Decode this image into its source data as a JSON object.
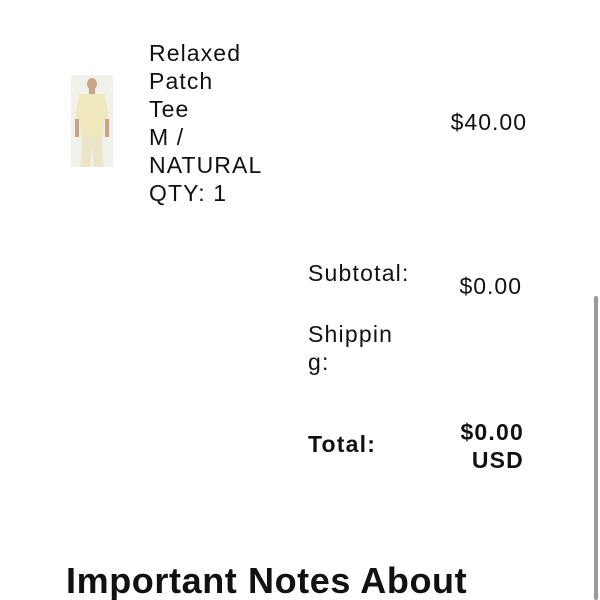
{
  "cart_item": {
    "name_lines": [
      "Relaxed",
      "Patch",
      "Tee"
    ],
    "variant_lines": [
      "M /",
      "NATURAL"
    ],
    "quantity": "QTY: 1",
    "price": "$40.00",
    "thumbnail_icon": "product-photo-person-in-tee"
  },
  "summary": {
    "subtotal_label": "Subtotal:",
    "subtotal_value": "$0.00",
    "shipping_label": "Shipping:",
    "shipping_value": "",
    "total_label": "Total:",
    "total_amount": "$0.00",
    "total_currency": "USD"
  },
  "notes_heading": "Important Notes About",
  "colors": {
    "text": "#111111",
    "background": "#ffffff",
    "scrollbar": "#9a9a9a"
  }
}
